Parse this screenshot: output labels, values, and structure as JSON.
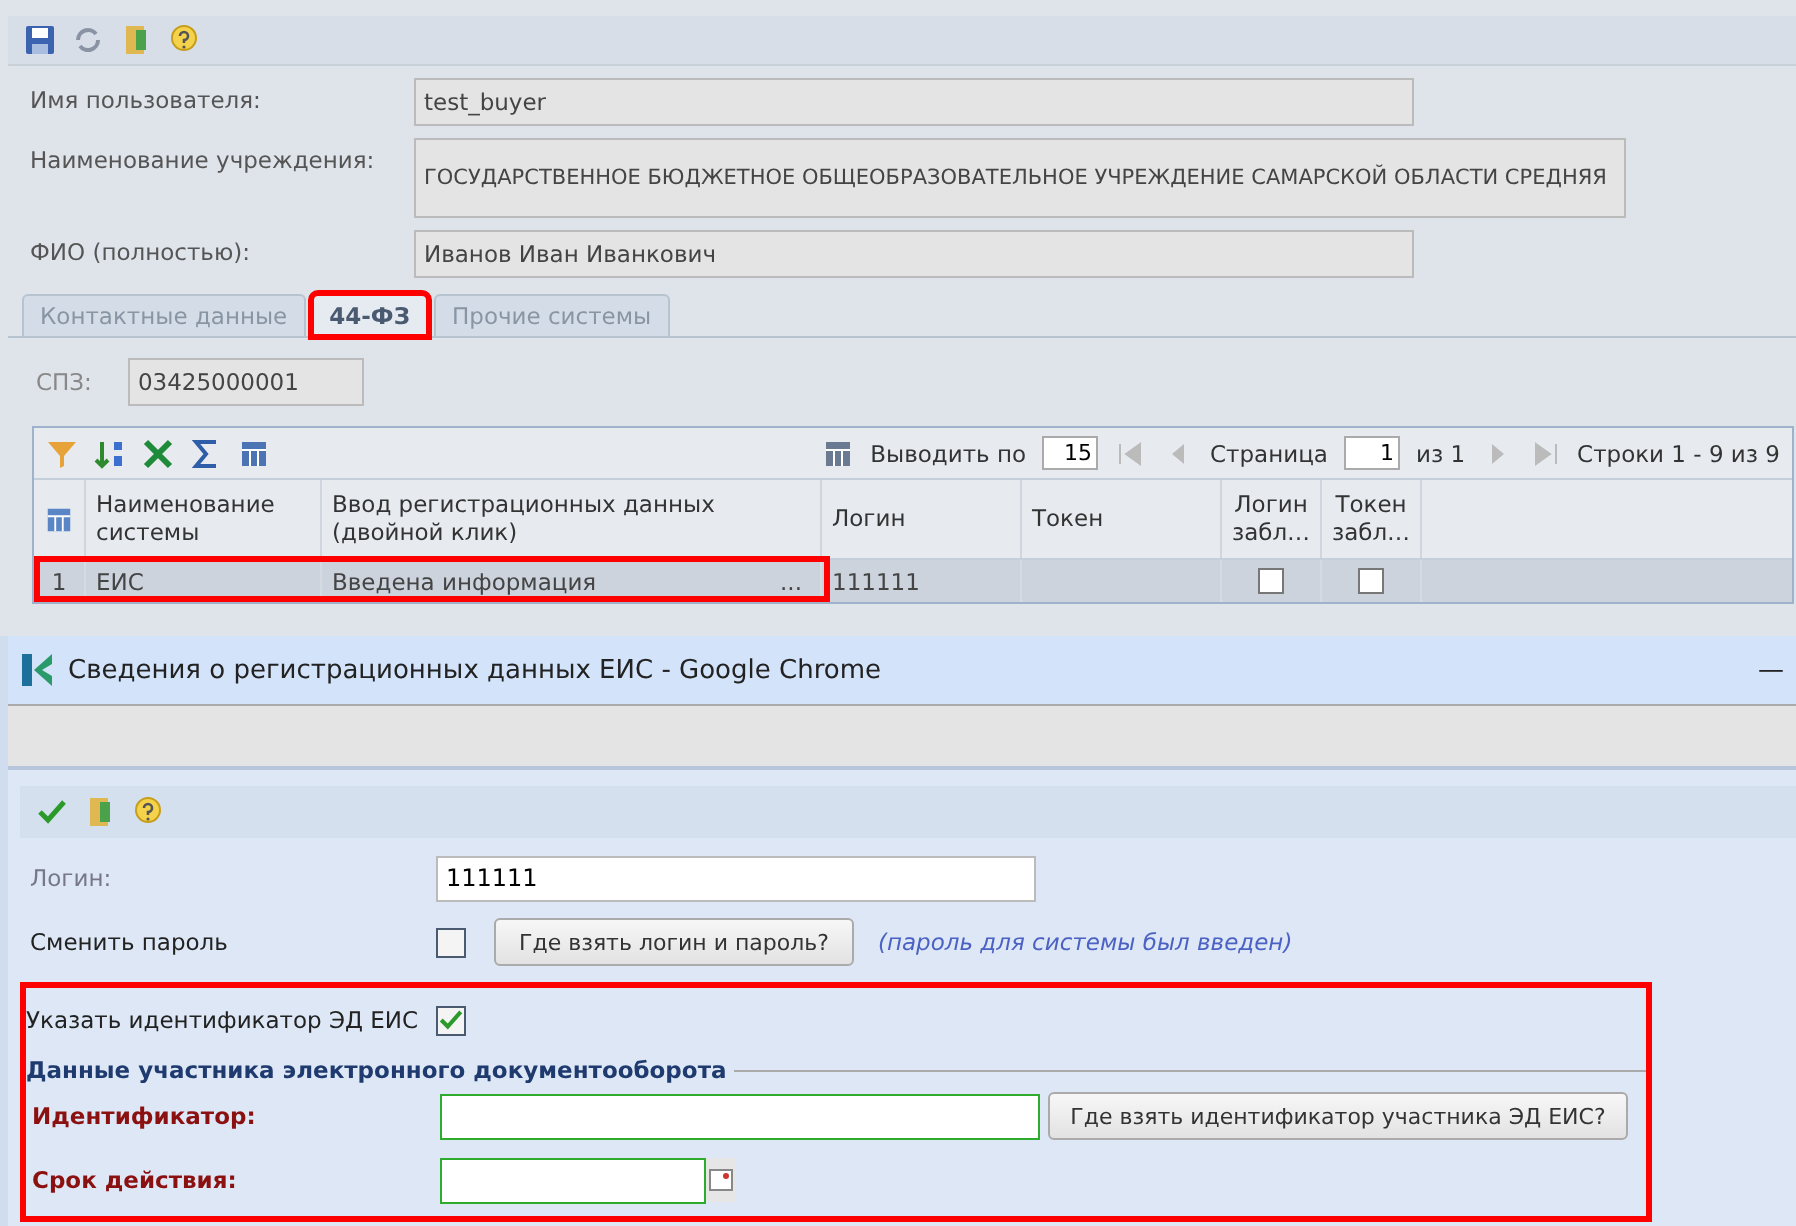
{
  "form": {
    "fields": [
      {
        "label": "Имя пользователя:",
        "value": "test_buyer",
        "kind": "single"
      },
      {
        "label": "Наименование учреждения:",
        "value": "ГОСУДАРСТВЕННОЕ БЮДЖЕТНОЕ ОБЩЕОБРАЗОВАТЕЛЬНОЕ УЧРЕЖДЕНИЕ САМАРСКОЙ ОБЛАСТИ СРЕДНЯЯ",
        "kind": "tall"
      },
      {
        "label": "ФИО (полностью):",
        "value": "Иванов Иван Иванкович",
        "kind": "single"
      }
    ]
  },
  "tabs": [
    {
      "label": "Контактные данные",
      "selected": false,
      "highlighted": false
    },
    {
      "label": "44-ФЗ",
      "selected": true,
      "highlighted": true
    },
    {
      "label": "Прочие системы",
      "selected": false,
      "highlighted": false
    }
  ],
  "spz": {
    "label": "СПЗ:",
    "value": "03425000001"
  },
  "grid": {
    "page_size_label": "Выводить по",
    "page_size": "15",
    "page_label": "Страница",
    "page": "1",
    "page_of": "из 1",
    "rows_info": "Строки 1 - 9 из 9",
    "columns": [
      "Наименование системы",
      "Ввод регистрационных данных (двойной клик)",
      "Логин",
      "Токен",
      "Логин забл…",
      "Токен забл…"
    ],
    "rows": [
      {
        "number": "1",
        "system": "ЕИС",
        "entry": "Введена информация",
        "ellipsis": "...",
        "login": "111111",
        "login_blocked": false,
        "token_blocked": false,
        "highlighted": true
      }
    ]
  },
  "dialog": {
    "title": "Сведения о регистрационных данных ЕИС - Google Chrome",
    "minimize": "—",
    "login_label": "Логин:",
    "login_value": "111111",
    "change_password_label": "Сменить пароль",
    "change_password": false,
    "where_login_button": "Где взять логин и пароль?",
    "password_note": "(пароль для системы был введен)",
    "specify_id_label": "Указать идентификатор ЭД ЕИС",
    "specify_id": true,
    "section_title": "Данные участника электронного документооборота",
    "id_label": "Идентификатор:",
    "where_id_button": "Где взять идентификатор участника ЭД ЕИС?",
    "validity_label": "Срок действия:"
  }
}
